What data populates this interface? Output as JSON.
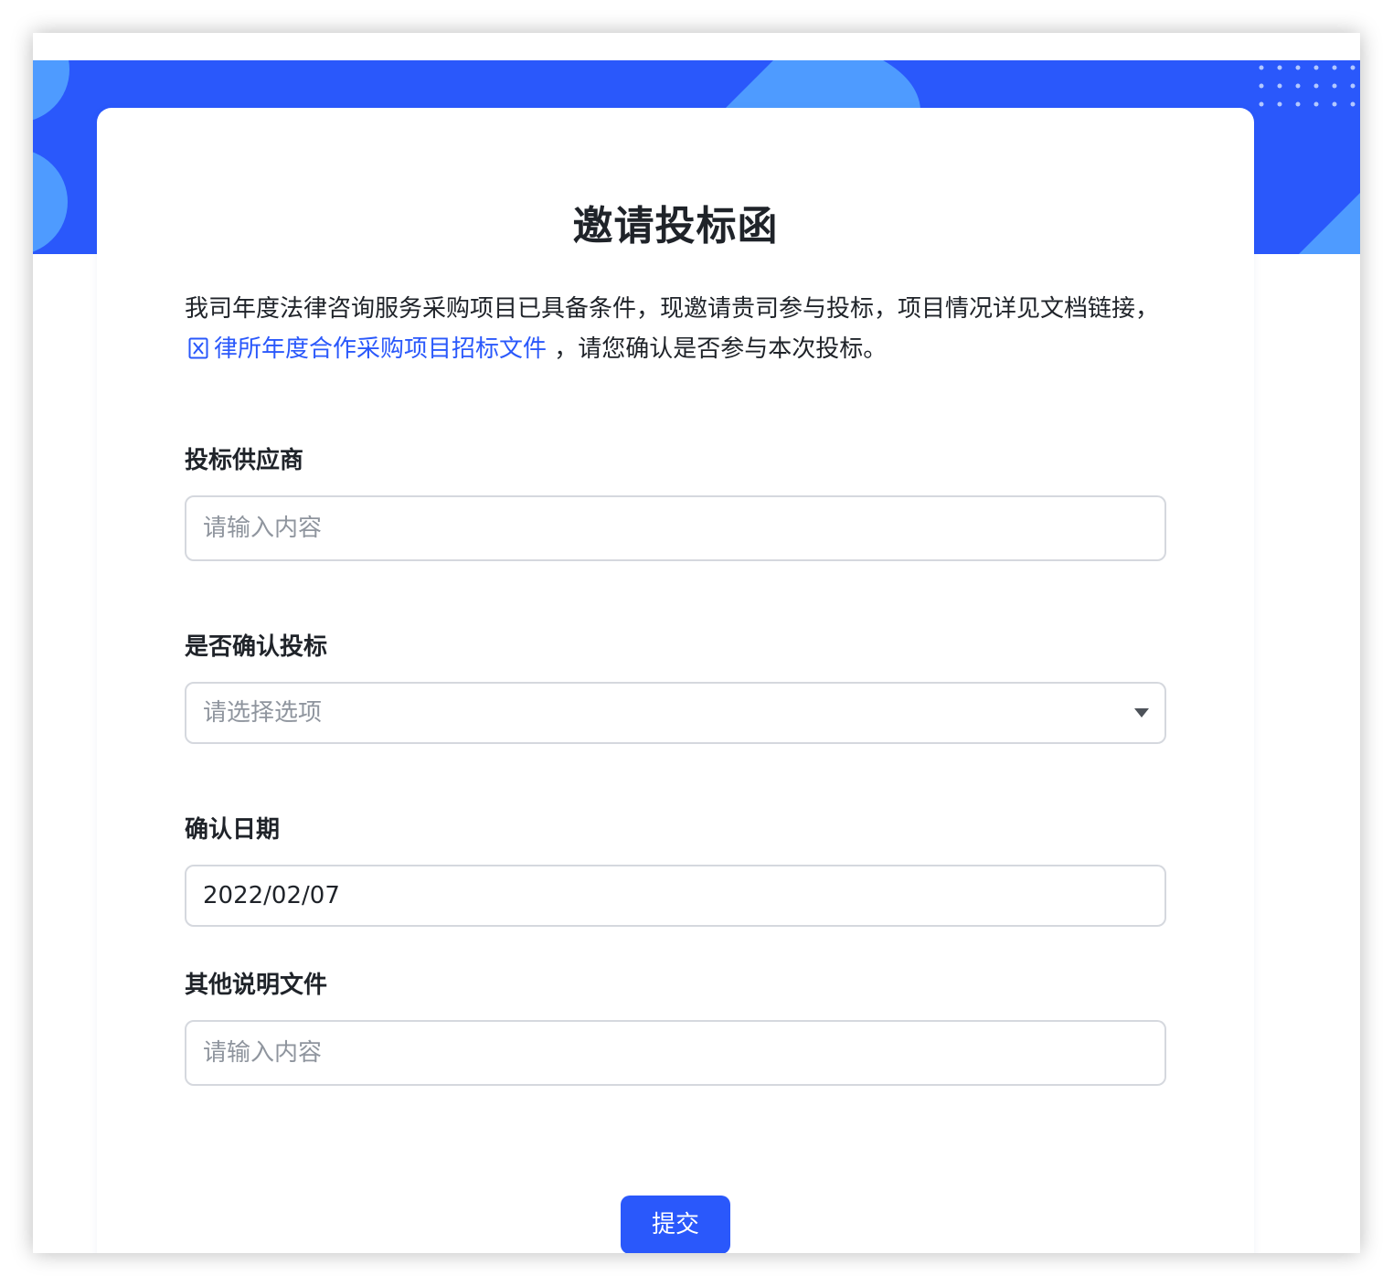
{
  "form": {
    "title": "邀请投标函",
    "intro_before": "我司年度法律咨询服务采购项目已具备条件，现邀请贵司参与投标，项目情况详见文档链接，",
    "doc_link_text": "律所年度合作采购项目招标文件",
    "intro_after": " ，请您确认是否参与本次投标。",
    "doc_icon": "word-document-icon"
  },
  "fields": {
    "supplier": {
      "label": "投标供应商",
      "placeholder": "请输入内容",
      "value": ""
    },
    "confirm": {
      "label": "是否确认投标",
      "placeholder": "请选择选项",
      "icon": "caret-down-icon"
    },
    "date": {
      "label": "确认日期",
      "value": "2022/02/07"
    },
    "other_docs": {
      "label": "其他说明文件",
      "placeholder": "请输入内容",
      "value": ""
    }
  },
  "submit_label": "提交",
  "colors": {
    "primary": "#2a58fb",
    "banner_light": "#4e9bff",
    "text": "#1f2329",
    "placeholder": "#8f959e",
    "border": "#d5d8de"
  }
}
